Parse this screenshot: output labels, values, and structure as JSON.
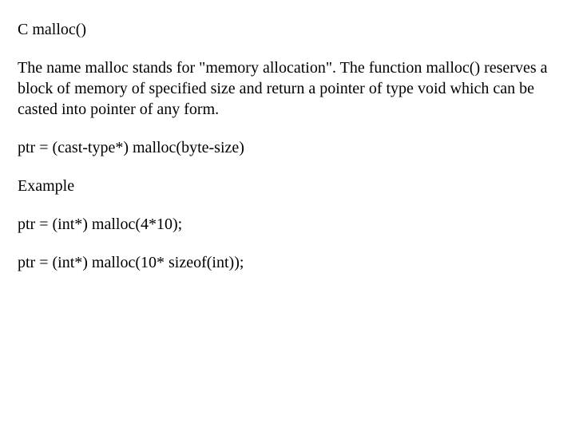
{
  "title": "C malloc()",
  "intro": "The name malloc stands for \"memory allocation\".\nThe function malloc() reserves a block of memory of specified size and return a pointer of type void which can be casted into pointer of any form.",
  "syntax": "ptr = (cast-type*) malloc(byte-size)",
  "example_label": "Example",
  "example1": "ptr = (int*) malloc(4*10);",
  "example2": "ptr = (int*) malloc(10* sizeof(int));"
}
